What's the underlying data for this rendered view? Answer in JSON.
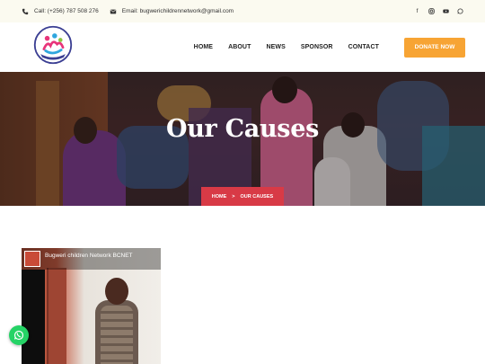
{
  "topbar": {
    "call": "Call: (+256) 787 508 276",
    "email": "Email: bugwerichildrennetwork@gmail.com",
    "social_icons": [
      "facebook-icon",
      "instagram-icon",
      "youtube-icon",
      "whatsapp-icon"
    ]
  },
  "nav": {
    "items": [
      "HOME",
      "ABOUT",
      "NEWS",
      "SPONSOR",
      "CONTACT"
    ],
    "donate_label": "DONATE NOW"
  },
  "hero": {
    "title": "Our Causes",
    "breadcrumb": {
      "home": "HOME",
      "separator": ">",
      "current": "OUR CAUSES"
    }
  },
  "video": {
    "title": "Bugweri children Network BCNET"
  },
  "colors": {
    "accent_orange": "#f7a434",
    "breadcrumb_red": "#d83a46",
    "whatsapp_green": "#25d366",
    "topbar_bg": "#fbfaf0"
  }
}
